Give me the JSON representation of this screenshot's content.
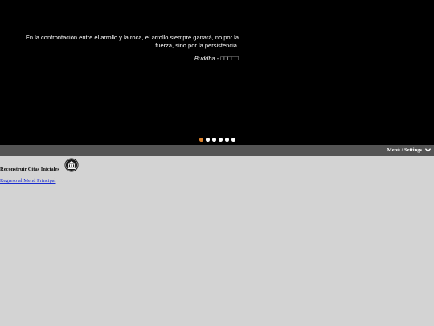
{
  "hero": {
    "quote": "En la confrontación entre el arrollo y la roca, el arrollo siempre ganará, no por la fuerza, sino por la persistencia.",
    "author": "Buddha",
    "author_separator": " - ",
    "author_extra": "□□□□□",
    "carousel_dots": 6,
    "active_dot": 0,
    "active_dot_color": "#e0852f"
  },
  "menubar": {
    "label": "Menú / Settings",
    "icon": "chevron-down-icon"
  },
  "main": {
    "title": "Reconstruir Citas Iniciales",
    "logo_icon": "building-logo-icon",
    "back_link": "Regreso al Menú Principal"
  },
  "colors": {
    "hero_bg": "#000000",
    "menubar_bg": "#545454",
    "page_bg": "#d3d3d3",
    "link": "#1a2ccf"
  }
}
